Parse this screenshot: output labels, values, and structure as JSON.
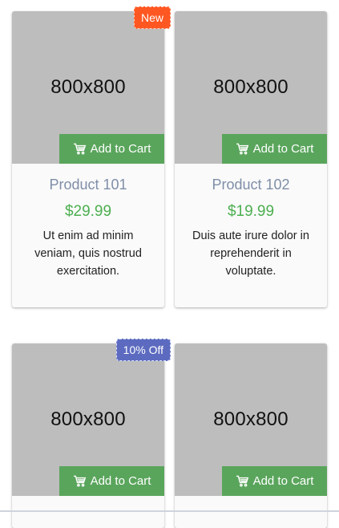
{
  "placeholder_text": "800x800",
  "add_to_cart_label": "Add to Cart",
  "products": [
    {
      "badge": "New",
      "title": "Product 101",
      "price": "$29.99",
      "description": "Ut enim ad minim veniam, quis nostrud exercitation."
    },
    {
      "badge": "",
      "title": "Product 102",
      "price": "$19.99",
      "description": "Duis aute irure dolor in reprehenderit in voluptate."
    },
    {
      "badge": "10% Off",
      "title": "",
      "price": "",
      "description": ""
    },
    {
      "badge": "",
      "title": "",
      "price": "",
      "description": ""
    }
  ],
  "colors": {
    "placeholder_bg": "#bdbdbd",
    "button_green": "#5aa55c",
    "price_green": "#4caf50",
    "title_blue_gray": "#7f8ea8",
    "badge_new": "#ff5722",
    "badge_discount": "#5c6bc0"
  },
  "icons": {
    "cart": "shopping-cart-icon"
  }
}
